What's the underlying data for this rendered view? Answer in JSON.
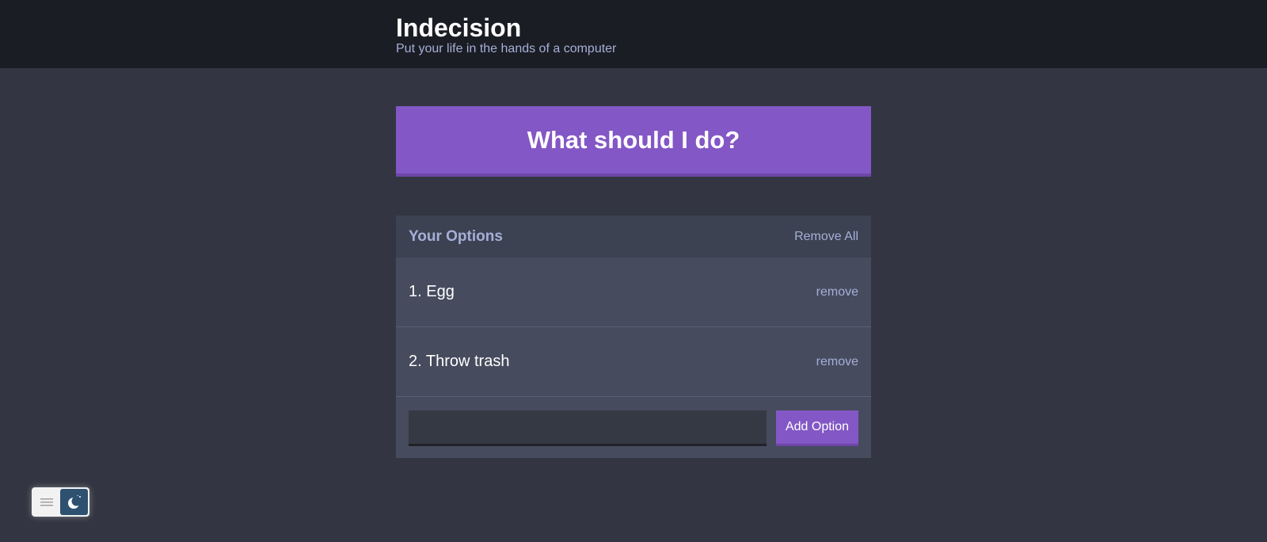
{
  "header": {
    "title": "Indecision",
    "subtitle": "Put your life in the hands of a computer"
  },
  "action": {
    "label": "What should I do?"
  },
  "options_widget": {
    "title": "Your Options",
    "remove_all_label": "Remove All",
    "remove_label": "remove",
    "items": [
      {
        "text": "1. Egg"
      },
      {
        "text": "2. Throw trash"
      }
    ],
    "add_input_value": "",
    "add_button_label": "Add Option"
  },
  "theme_toggle": {
    "icons": [
      "menu-icon",
      "moon-icon"
    ]
  },
  "colors": {
    "background": "#333642",
    "header": "#1b1d24",
    "accent": "#8357c5",
    "widget": "#464b5e",
    "muted_text": "#a5afd7"
  }
}
